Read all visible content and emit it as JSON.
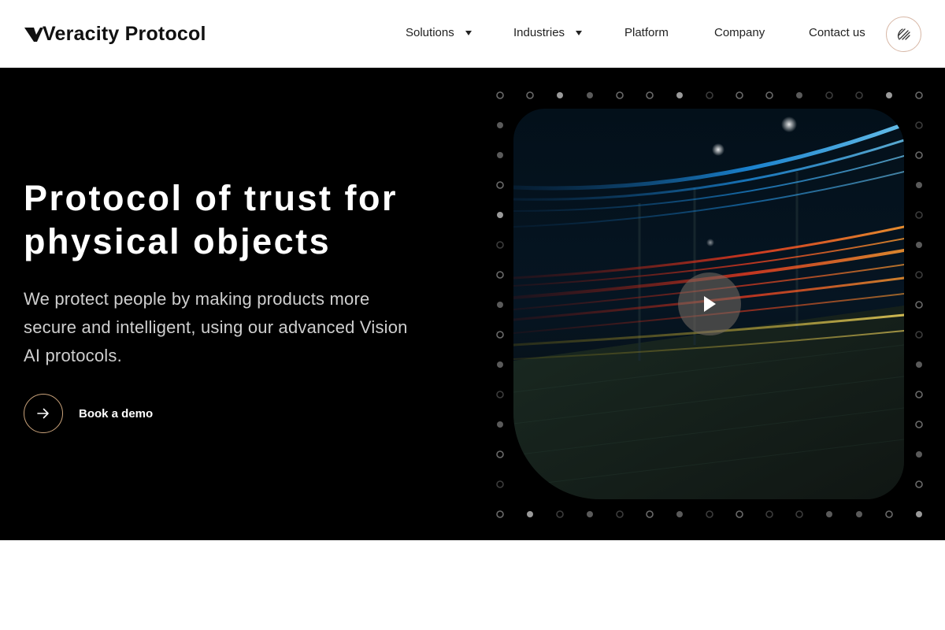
{
  "header": {
    "logo_text": "Veracity Protocol",
    "nav": [
      {
        "label": "Solutions",
        "has_dropdown": true
      },
      {
        "label": "Industries",
        "has_dropdown": true
      },
      {
        "label": "Platform",
        "has_dropdown": false
      },
      {
        "label": "Company",
        "has_dropdown": false
      },
      {
        "label": "Contact us",
        "has_dropdown": false
      }
    ],
    "brand_icon": "hatched-circle-icon"
  },
  "hero": {
    "title_line1": "Protocol of trust for",
    "title_line2": "physical objects",
    "subtitle": "We protect people by making products more secure and intelligent, using our advanced Vision AI protocols.",
    "cta_label": "Book a demo",
    "cta_icon": "arrow-right-icon",
    "video_play_icon": "play-icon"
  },
  "colors": {
    "hero_background": "#000000",
    "accent_border": "#c9a27a",
    "text_dark": "#222222"
  }
}
